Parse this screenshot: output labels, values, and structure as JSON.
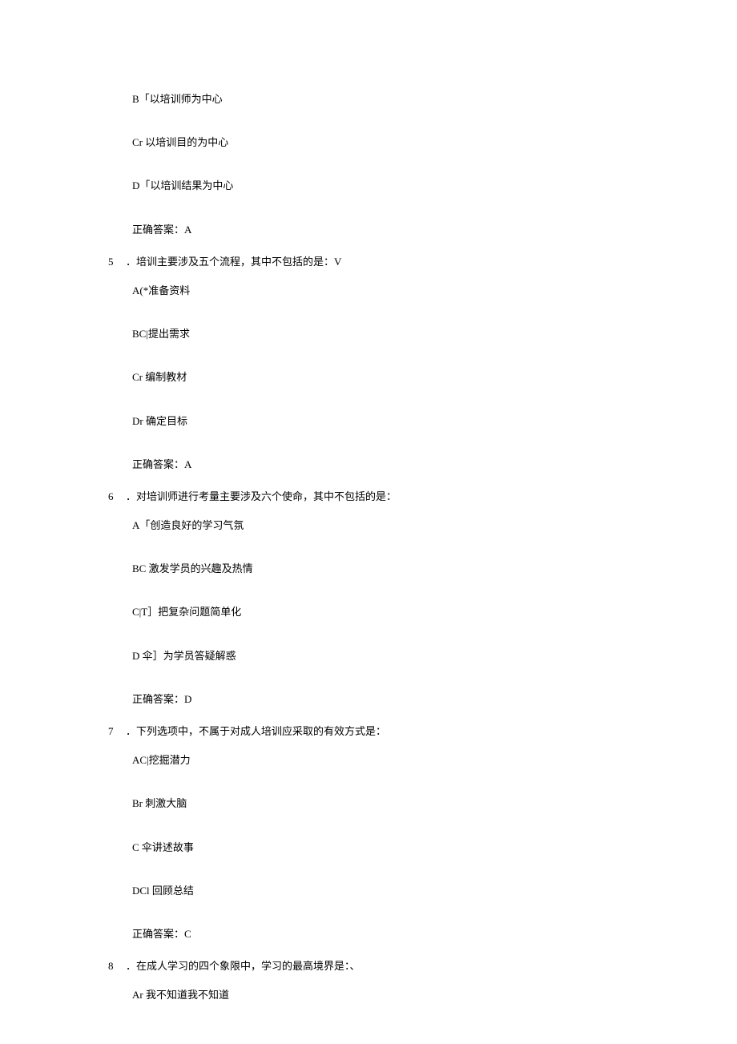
{
  "lines": [
    {
      "type": "option",
      "text": "B「以培训师为中心"
    },
    {
      "type": "option",
      "text": "Cr 以培训目的为中心"
    },
    {
      "type": "option",
      "text": "D「以培训结果为中心"
    },
    {
      "type": "answer",
      "text": "正确答案：A"
    },
    {
      "type": "question",
      "num": "5",
      "text": "．培训主要涉及五个流程，其中不包括的是：V"
    },
    {
      "type": "option",
      "text": "A(*准备资料"
    },
    {
      "type": "option",
      "text": "BC|提出需求"
    },
    {
      "type": "option",
      "text": "Cr 编制教材"
    },
    {
      "type": "option",
      "text": "Dr 确定目标"
    },
    {
      "type": "answer",
      "text": "正确答案：A"
    },
    {
      "type": "question",
      "num": "6",
      "text": "．对培训师进行考量主要涉及六个使命，其中不包括的是："
    },
    {
      "type": "option",
      "text": "A「创造良好的学习气氛"
    },
    {
      "type": "option",
      "text": "BC 激发学员的兴趣及热情"
    },
    {
      "type": "option",
      "text": "C|T］把复杂问题简单化"
    },
    {
      "type": "option",
      "text": "D 伞］为学员答疑解惑"
    },
    {
      "type": "answer",
      "text": "正确答案：D"
    },
    {
      "type": "question",
      "num": "7",
      "text": "．下列选项中，不属于对成人培训应采取的有效方式是："
    },
    {
      "type": "option",
      "text": "AC|挖掘潜力"
    },
    {
      "type": "option",
      "text": "Br 刺激大脑"
    },
    {
      "type": "option",
      "text": "C 伞讲述故事"
    },
    {
      "type": "option",
      "text": "DCl 回顾总结"
    },
    {
      "type": "answer",
      "text": "正确答案：C"
    },
    {
      "type": "question",
      "num": "8",
      "text": "．在成人学习的四个象限中，学习的最高境界是：、"
    },
    {
      "type": "option-last",
      "text": "Ar 我不知道我不知道"
    }
  ]
}
